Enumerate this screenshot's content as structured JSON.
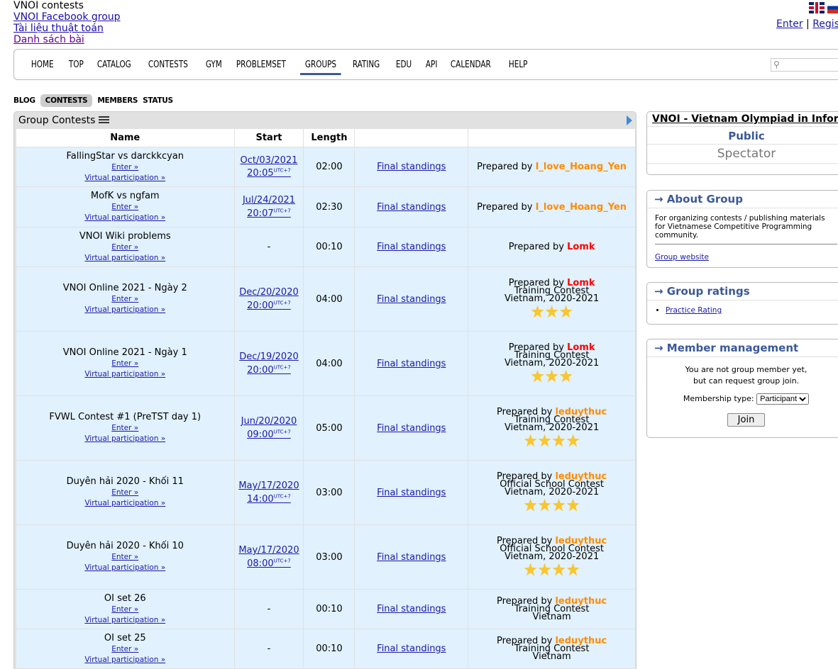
{
  "header": {
    "links": [
      "VNOI contests",
      "VNOI Facebook group",
      "Tài liệu thuật toán",
      "Danh sách bài"
    ],
    "auth": {
      "enter": "Enter",
      "sep": "|",
      "register": "Register"
    }
  },
  "menu": {
    "items": [
      "HOME",
      "TOP",
      "CATALOG",
      "CONTESTS",
      "GYM",
      "PROBLEMSET",
      "GROUPS",
      "RATING",
      "EDU",
      "API",
      "CALENDAR",
      "HELP"
    ],
    "active": "GROUPS"
  },
  "subtabs": {
    "items": [
      "BLOG",
      "CONTESTS",
      "MEMBERS",
      "STATUS"
    ],
    "active": "CONTESTS"
  },
  "contests": {
    "title": "Group Contests",
    "headers": {
      "name": "Name",
      "start": "Start",
      "length": "Length"
    },
    "enter_label": "Enter »",
    "virtual_label": "Virtual participation »",
    "standings_label": "Final standings",
    "prepared_label": "Prepared by",
    "utc": "UTC+7",
    "rows": [
      {
        "name": "FallingStar vs darckkcyan",
        "date": "Oct/03/2021",
        "time": "20:05",
        "length": "02:00",
        "author": "I_love_Hoang_Yen",
        "author_color": "#ff8c00",
        "type": "",
        "region": "",
        "stars": 0
      },
      {
        "name": "MofK vs ngfam",
        "date": "Jul/24/2021",
        "time": "20:07",
        "length": "02:30",
        "author": "I_love_Hoang_Yen",
        "author_color": "#ff8c00",
        "type": "",
        "region": "",
        "stars": 0
      },
      {
        "name": "VNOI Wiki problems",
        "date": "",
        "time": "",
        "length": "00:10",
        "author": "Lomk",
        "author_color": "#ff0000",
        "type": "",
        "region": "",
        "stars": 0
      },
      {
        "name": "VNOI Online 2021 - Ngày 2",
        "date": "Dec/20/2020",
        "time": "20:00",
        "length": "04:00",
        "author": "Lomk",
        "author_color": "#ff0000",
        "type": "Training Contest",
        "region": "Vietnam, 2020-2021",
        "stars": 3
      },
      {
        "name": "VNOI Online 2021 - Ngày 1",
        "date": "Dec/19/2020",
        "time": "20:00",
        "length": "04:00",
        "author": "Lomk",
        "author_color": "#ff0000",
        "type": "Training Contest",
        "region": "Vietnam, 2020-2021",
        "stars": 3
      },
      {
        "name": "FVWL Contest #1 (PreTST day 1)",
        "date": "Jun/20/2020",
        "time": "09:00",
        "length": "05:00",
        "author": "leduythuc",
        "author_color": "#ff8c00",
        "type": "Training Contest",
        "region": "Vietnam, 2020-2021",
        "stars": 4
      },
      {
        "name": "Duyên hải 2020 - Khối 11",
        "date": "May/17/2020",
        "time": "14:00",
        "length": "03:00",
        "author": "leduythuc",
        "author_color": "#ff8c00",
        "type": "Official School Contest",
        "region": "Vietnam, 2020-2021",
        "stars": 4
      },
      {
        "name": "Duyên hải 2020 - Khối 10",
        "date": "May/17/2020",
        "time": "08:00",
        "length": "03:00",
        "author": "leduythuc",
        "author_color": "#ff8c00",
        "type": "Official School Contest",
        "region": "Vietnam, 2020-2021",
        "stars": 4
      },
      {
        "name": "OI set 26",
        "date": "",
        "time": "",
        "length": "00:10",
        "author": "leduythuc",
        "author_color": "#ff8c00",
        "type": "Training Contest",
        "region": "Vietnam",
        "stars": 0
      },
      {
        "name": "OI set 25",
        "date": "",
        "time": "",
        "length": "00:10",
        "author": "leduythuc",
        "author_color": "#ff8c00",
        "type": "Training Contest",
        "region": "Vietnam",
        "stars": 0
      }
    ]
  },
  "sidebar": {
    "group_title": "VNOI - Vietnam Olympiad in Informatics",
    "visibility": "Public",
    "role": "Spectator",
    "about": {
      "caption": "→ About Group",
      "text": "For organizing contests / publishing materials for Vietnamese Competitive Programming community.",
      "link": "Group website"
    },
    "ratings": {
      "caption": "→ Group ratings",
      "item": "Practice Rating"
    },
    "member": {
      "caption": "→ Member management",
      "line1": "You are not group member yet,",
      "line2": "but can request group join.",
      "type_label": "Membership type:",
      "type_value": "Participant",
      "join": "Join"
    }
  }
}
